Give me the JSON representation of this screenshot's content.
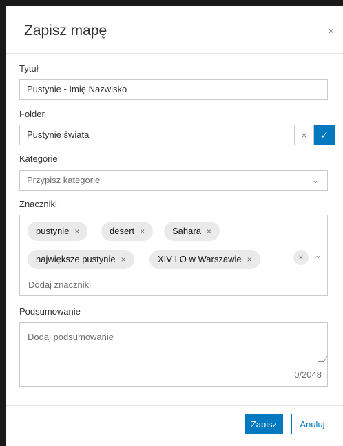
{
  "dialog": {
    "title": "Zapisz mapę",
    "close_icon": "×"
  },
  "fields": {
    "title_label": "Tytuł",
    "title_value": "Pustynie - Imię Nazwisko",
    "folder_label": "Folder",
    "folder_value": "Pustynie świata",
    "folder_clear_icon": "×",
    "folder_confirm_icon": "✓",
    "categories_label": "Kategorie",
    "categories_placeholder": "Przypisz kategorie",
    "chevron_icon": "⌄",
    "tags_label": "Znaczniki",
    "tags": [
      "pustynie",
      "desert",
      "Sahara",
      "największe pustynie",
      "XIV LO w Warszawie"
    ],
    "tag_remove_icon": "×",
    "tags_placeholder": "Dodaj znaczniki",
    "summary_label": "Podsumowanie",
    "summary_placeholder": "Dodaj podsumowanie",
    "summary_counter": "0/2048"
  },
  "footer": {
    "save_label": "Zapisz",
    "cancel_label": "Anuluj"
  },
  "colors": {
    "accent": "#0079c1",
    "chip_bg": "#eaeaea",
    "border": "#cacaca"
  }
}
